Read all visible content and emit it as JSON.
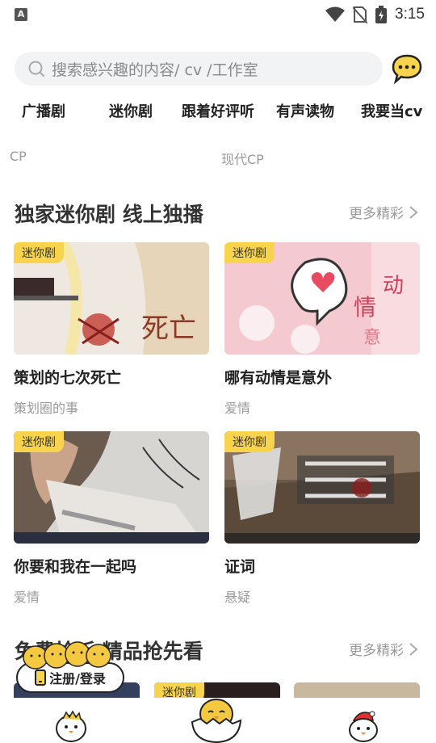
{
  "status": {
    "time": "3:15",
    "left_icon": "A"
  },
  "search": {
    "placeholder": "搜索感兴趣的内容/ cv /工作室"
  },
  "categories": [
    "广播剧",
    "迷你剧",
    "跟着好评听",
    "有声读物",
    "我要当cv"
  ],
  "subcategories": [
    "CP",
    "现代CP"
  ],
  "section1": {
    "title": "独家迷你剧  线上独播",
    "more": "更多精彩",
    "cards": [
      {
        "badge": "迷你剧",
        "title": "策划的七次死亡",
        "sub": "策划圈的事"
      },
      {
        "badge": "迷你剧",
        "title": "哪有动情是意外",
        "sub": "爱情"
      },
      {
        "badge": "迷你剧",
        "title": "你要和我在一起吗",
        "sub": "爱情"
      },
      {
        "badge": "迷你剧",
        "title": "证词",
        "sub": "悬疑"
      }
    ]
  },
  "section2": {
    "title": "免费抢听  精品抢先看",
    "more": "更多精彩",
    "badge": "迷你剧"
  },
  "login": {
    "label": "注册/登录"
  },
  "colors": {
    "badge": "#f8d44d",
    "accent_yellow": "#f5c842"
  }
}
